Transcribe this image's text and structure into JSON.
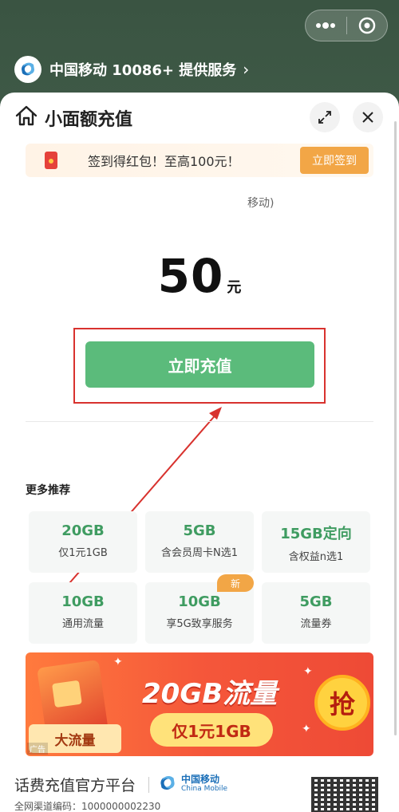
{
  "provider": {
    "logo_text": "中国移动",
    "label": "中国移动 10086+ 提供服务"
  },
  "page": {
    "title": "小面额充值"
  },
  "banner": {
    "text": "签到得红包！至高100元！",
    "button": "立即签到"
  },
  "carrier_hint": "移动)",
  "amount": {
    "value": "50",
    "unit": "元"
  },
  "recharge_button": "立即充值",
  "more": {
    "title": "更多推荐",
    "cards": [
      {
        "big": "20GB",
        "small": "仅1元1GB"
      },
      {
        "big": "5GB",
        "small": "含会员周卡N选1"
      },
      {
        "big": "15GB定向",
        "small": "含权益n选1"
      },
      {
        "big": "10GB",
        "small": "通用流量"
      },
      {
        "big": "10GB",
        "small": "享5G致享服务",
        "badge": "新"
      },
      {
        "big": "5GB",
        "small": "流量券"
      }
    ]
  },
  "ad": {
    "headline": "20GB流量",
    "price": "仅1元1GB",
    "tag": "大流量",
    "grab": "抢",
    "label": "广告"
  },
  "footer": {
    "platform": "话费充值官方平台",
    "brand_zh": "中国移动",
    "brand_en": "China Mobile",
    "channel_code": "全网渠道编码：1000000002230"
  },
  "colors": {
    "primary_green": "#5bbb7b",
    "accent_orange": "#f2a646",
    "highlight_red": "#d8322e"
  }
}
